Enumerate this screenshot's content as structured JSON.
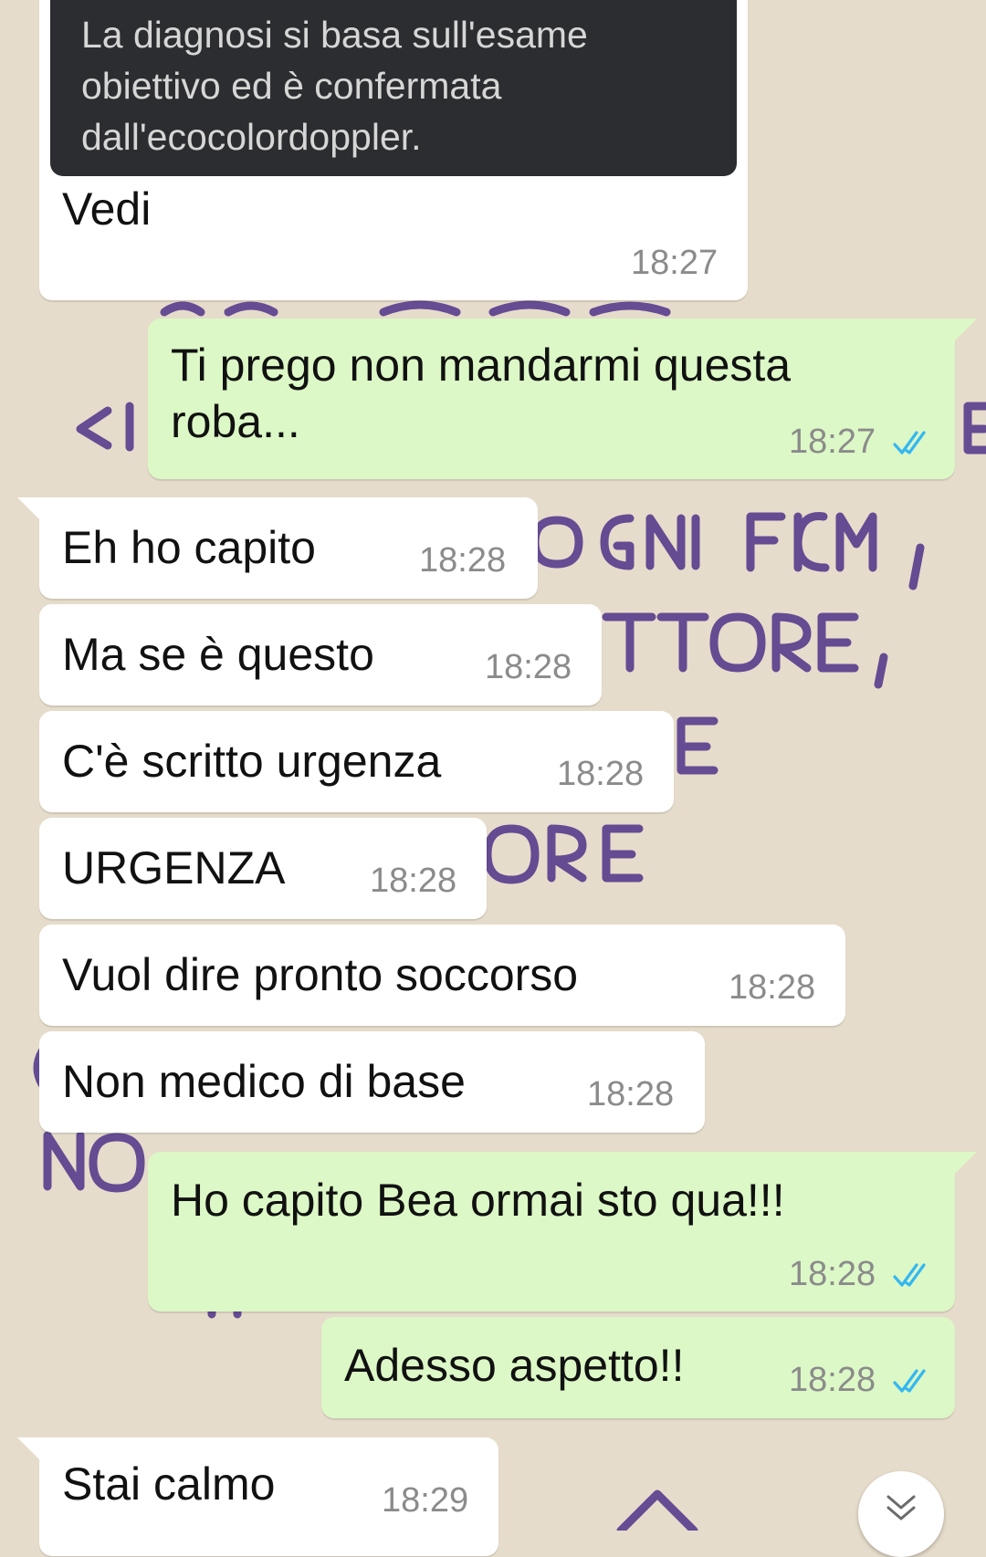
{
  "chat": {
    "quoted_message": {
      "text": "La diagnosi si basa sull'esame obiettivo ed è confermata dall'ecocolordoppler."
    },
    "messages": [
      {
        "direction": "incoming",
        "text": "Vedi",
        "time": "18:27"
      },
      {
        "direction": "outgoing",
        "text": "Ti prego non mandarmi questa roba...",
        "time": "18:27",
        "status": "read"
      },
      {
        "direction": "incoming",
        "text": "Eh ho capito",
        "time": "18:28"
      },
      {
        "direction": "incoming",
        "text": "Ma se è questo",
        "time": "18:28"
      },
      {
        "direction": "incoming",
        "text": "C'è scritto urgenza",
        "time": "18:28"
      },
      {
        "direction": "incoming",
        "text": "URGENZA",
        "time": "18:28"
      },
      {
        "direction": "incoming",
        "text": "Vuol dire pronto soccorso",
        "time": "18:28"
      },
      {
        "direction": "incoming",
        "text": "Non medico di base",
        "time": "18:28"
      },
      {
        "direction": "outgoing",
        "text": "Ho capito Bea ormai sto qua!!!",
        "time": "18:28",
        "status": "read"
      },
      {
        "direction": "outgoing",
        "text": "Adesso aspetto!!",
        "time": "18:28",
        "status": "read"
      },
      {
        "direction": "incoming",
        "text": "Stai calmo",
        "time": "18:29"
      }
    ]
  },
  "colors": {
    "incoming_bubble": "#ffffff",
    "outgoing_bubble": "#dcf8c6",
    "read_ticks": "#34b7f1",
    "timestamp": "#8b8b8b",
    "quote_background": "#2c2d30",
    "wallpaper": "#e6dccb",
    "wallpaper_ink": "#5a3f8e"
  },
  "icons": {
    "read_receipt": "double-check-icon",
    "scroll_down": "chevron-double-down-icon"
  }
}
